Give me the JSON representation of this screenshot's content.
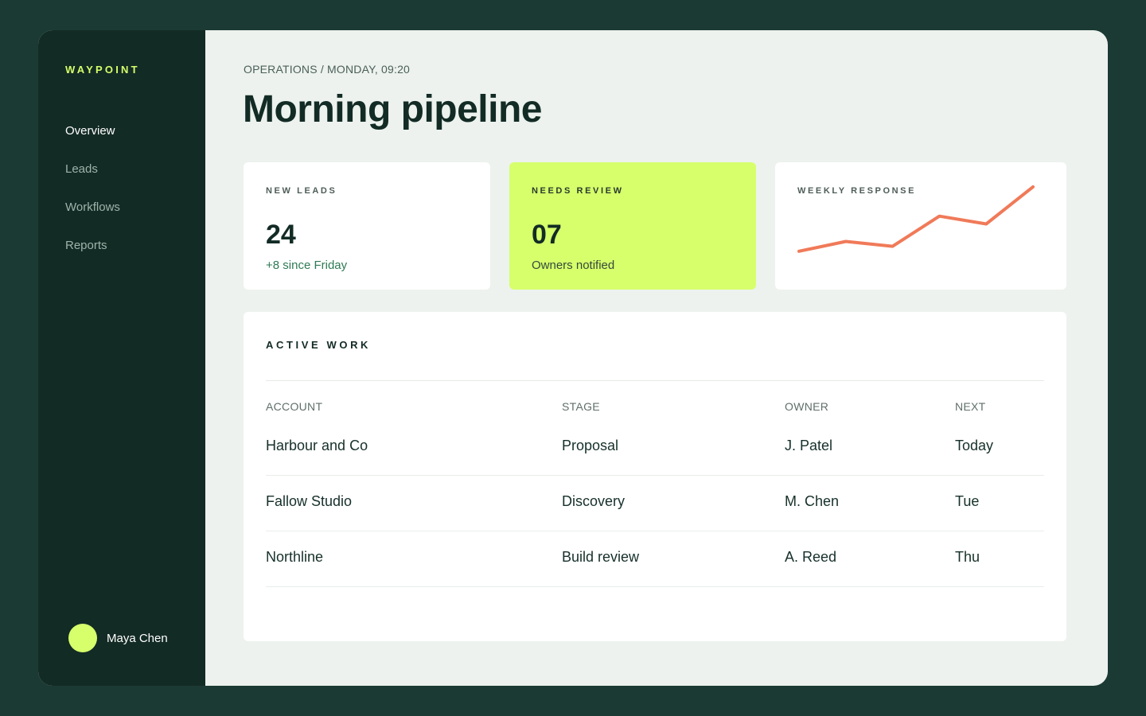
{
  "sidebar": {
    "brand": "WAYPOINT",
    "items": [
      {
        "label": "Overview",
        "active": true
      },
      {
        "label": "Leads",
        "active": false
      },
      {
        "label": "Workflows",
        "active": false
      },
      {
        "label": "Reports",
        "active": false
      }
    ],
    "user": {
      "name": "Maya Chen"
    }
  },
  "header": {
    "breadcrumb": "OPERATIONS / MONDAY, 09:20",
    "title": "Morning pipeline"
  },
  "cards": {
    "new_leads": {
      "label": "NEW LEADS",
      "value": "24",
      "sub": "+8 since Friday"
    },
    "needs_review": {
      "label": "NEEDS REVIEW",
      "value": "07",
      "sub": "Owners notified"
    },
    "weekly_response": {
      "label": "WEEKLY RESPONSE"
    }
  },
  "chart_data": {
    "type": "line",
    "x": [
      1,
      2,
      3,
      4,
      5,
      6
    ],
    "series": [
      {
        "values": [
          1,
          2,
          1.5,
          4.6,
          3.8,
          7.6
        ]
      }
    ],
    "ylim": [
      0,
      8
    ],
    "color": "#f07a59"
  },
  "active_work": {
    "title": "ACTIVE WORK",
    "columns": [
      "ACCOUNT",
      "STAGE",
      "OWNER",
      "NEXT"
    ],
    "rows": [
      [
        "Harbour and Co",
        "Proposal",
        "J. Patel",
        "Today"
      ],
      [
        "Fallow Studio",
        "Discovery",
        "M. Chen",
        "Tue"
      ],
      [
        "Northline",
        "Build review",
        "A. Reed",
        "Thu"
      ]
    ]
  },
  "colors": {
    "background": "#1b3a33",
    "sidebar": "#132b25",
    "accent": "#d6ff6b",
    "line": "#f07a59"
  }
}
